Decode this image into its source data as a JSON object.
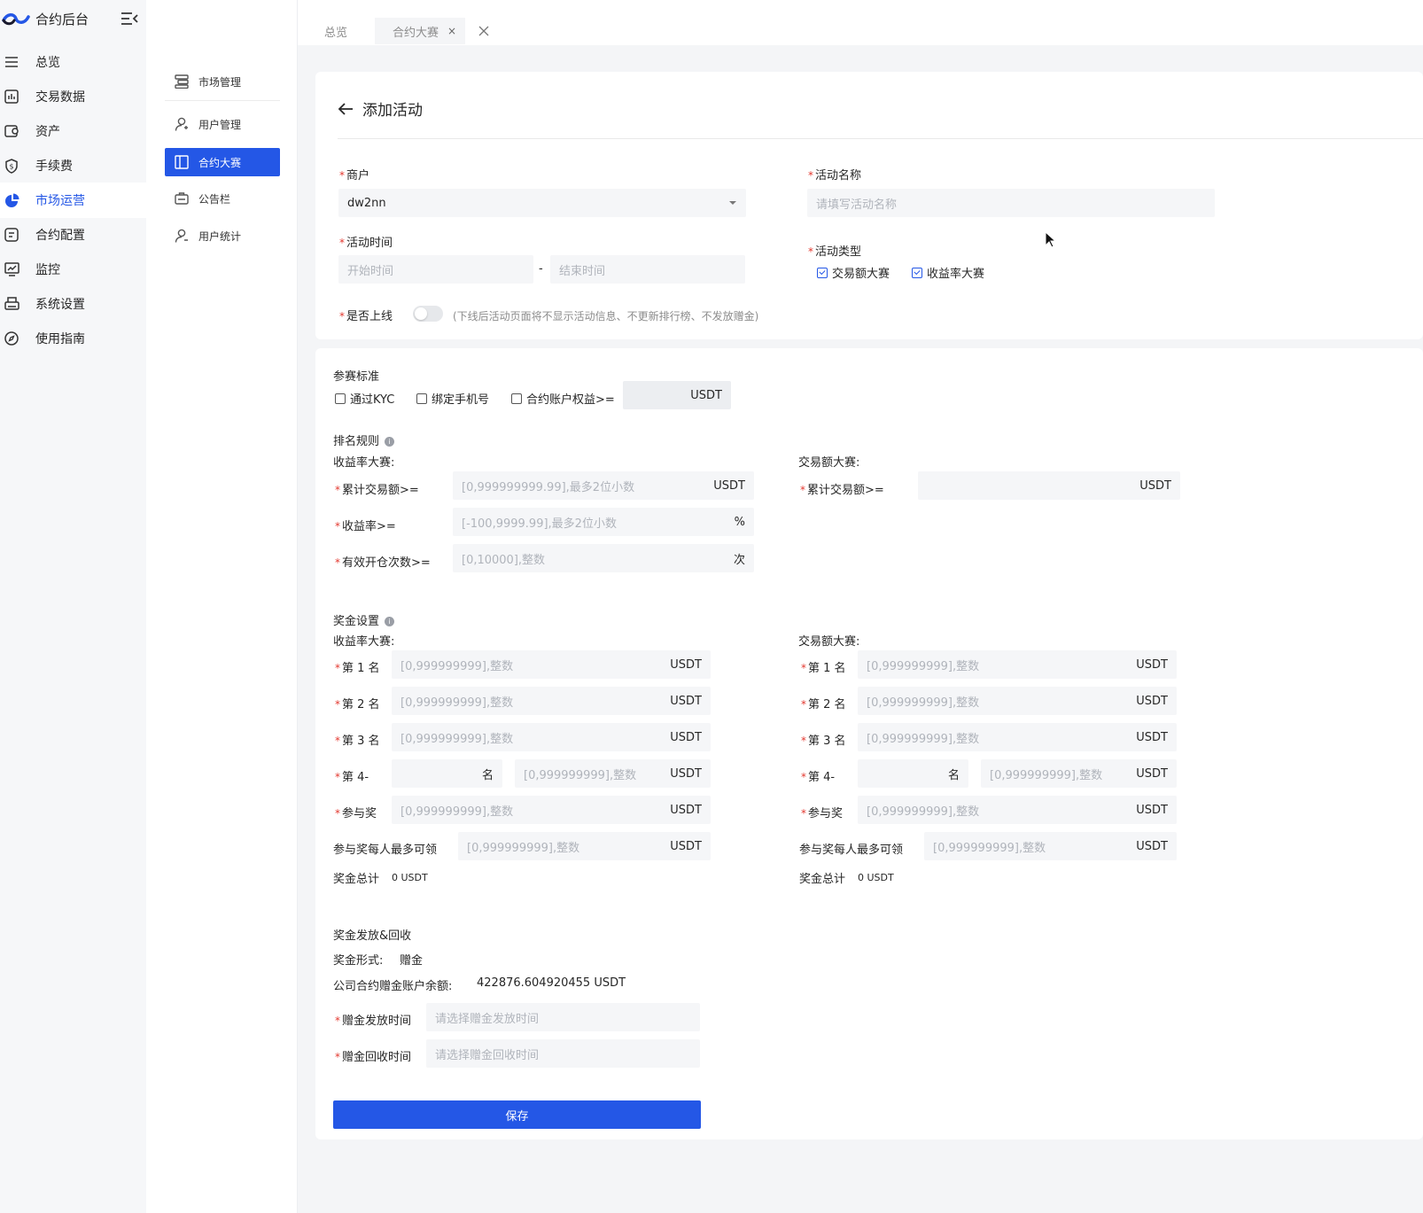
{
  "app": {
    "title": "合约后台"
  },
  "sidebar": {
    "items": [
      {
        "label": "总览",
        "icon": "list-icon"
      },
      {
        "label": "交易数据",
        "icon": "bar-chart-icon"
      },
      {
        "label": "资产",
        "icon": "wallet-icon"
      },
      {
        "label": "手续费",
        "icon": "shield-dollar-icon"
      },
      {
        "label": "市场运营",
        "icon": "pie-chart-icon",
        "active": true
      },
      {
        "label": "合约配置",
        "icon": "document-icon"
      },
      {
        "label": "监控",
        "icon": "monitor-icon"
      },
      {
        "label": "系统设置",
        "icon": "printer-icon"
      },
      {
        "label": "使用指南",
        "icon": "compass-icon"
      }
    ]
  },
  "subnav": {
    "items": [
      {
        "label": "市场管理",
        "icon": "server-icon"
      },
      {
        "label": "用户管理",
        "icon": "user-icon"
      },
      {
        "label": "合约大赛",
        "icon": "layout-icon",
        "active": true
      },
      {
        "label": "公告栏",
        "icon": "briefcase-icon"
      },
      {
        "label": "用户统计",
        "icon": "user-stats-icon"
      }
    ]
  },
  "tabs": [
    {
      "label": "总览"
    },
    {
      "label": "合约大赛",
      "close": "×",
      "active": true
    }
  ],
  "page": {
    "back_title": "添加活动"
  },
  "basic": {
    "merchant": {
      "label": "商户",
      "value": "dw2nn"
    },
    "activity_name": {
      "label": "活动名称",
      "placeholder": "请填写活动名称"
    },
    "activity_time": {
      "label": "活动时间",
      "start_placeholder": "开始时间",
      "separator": "-",
      "end_placeholder": "结束时间"
    },
    "activity_type": {
      "label": "活动类型",
      "options": [
        {
          "label": "交易额大赛",
          "checked": true
        },
        {
          "label": "收益率大赛",
          "checked": true
        }
      ]
    },
    "online": {
      "label": "是否上线",
      "hint": "(下线后活动页面将不显示活动信息、不更新排行榜、不发放赠金)",
      "on": false
    }
  },
  "criteria": {
    "title": "参赛标准",
    "kyc": "通过KYC",
    "phone": "绑定手机号",
    "equity": "合约账户权益>=",
    "equity_unit": "USDT"
  },
  "ranking": {
    "title": "排名规则",
    "yield": {
      "title": "收益率大赛:",
      "volume_label": "累计交易额>=",
      "volume_placeholder": "[0,999999999.99],最多2位小数",
      "volume_unit": "USDT",
      "rate_label": "收益率>=",
      "rate_placeholder": "[-100,9999.99],最多2位小数",
      "rate_unit": "%",
      "count_label": "有效开仓次数>=",
      "count_placeholder": "[0,10000],整数",
      "count_unit": "次"
    },
    "volume": {
      "title": "交易额大赛:",
      "volume_label": "累计交易额>=",
      "volume_unit": "USDT"
    }
  },
  "prize": {
    "title": "奖金设置",
    "placeholder": "[0,999999999],整数",
    "unit": "USDT",
    "yield": {
      "title": "收益率大赛:",
      "rank1": "第 1 名",
      "rank2": "第 2 名",
      "rank3": "第 3 名",
      "rank4": "第 4-",
      "rank4_suffix": "名",
      "participation": "参与奖",
      "per_person": "参与奖每人最多可领",
      "total_label": "奖金总计",
      "total_value": "0 USDT"
    },
    "volume": {
      "title": "交易额大赛:",
      "rank1": "第 1 名",
      "rank2": "第 2 名",
      "rank3": "第 3 名",
      "rank4": "第 4-",
      "rank4_suffix": "名",
      "participation": "参与奖",
      "per_person": "参与奖每人最多可领",
      "total_label": "奖金总计",
      "total_value": "0 USDT"
    }
  },
  "distribution": {
    "title": "奖金发放&回收",
    "form_label": "奖金形式:",
    "form_value": "赠金",
    "balance_label": "公司合约赠金账户余额:",
    "balance_value": "422876.604920455 USDT",
    "issue_label": "赠金发放时间",
    "issue_placeholder": "请选择赠金发放时间",
    "recall_label": "赠金回收时间",
    "recall_placeholder": "请选择赠金回收时间"
  },
  "actions": {
    "save": "保存"
  },
  "colors": {
    "primary": "#2457e6",
    "required": "#e3382f",
    "input_bg": "#f5f6f8"
  }
}
